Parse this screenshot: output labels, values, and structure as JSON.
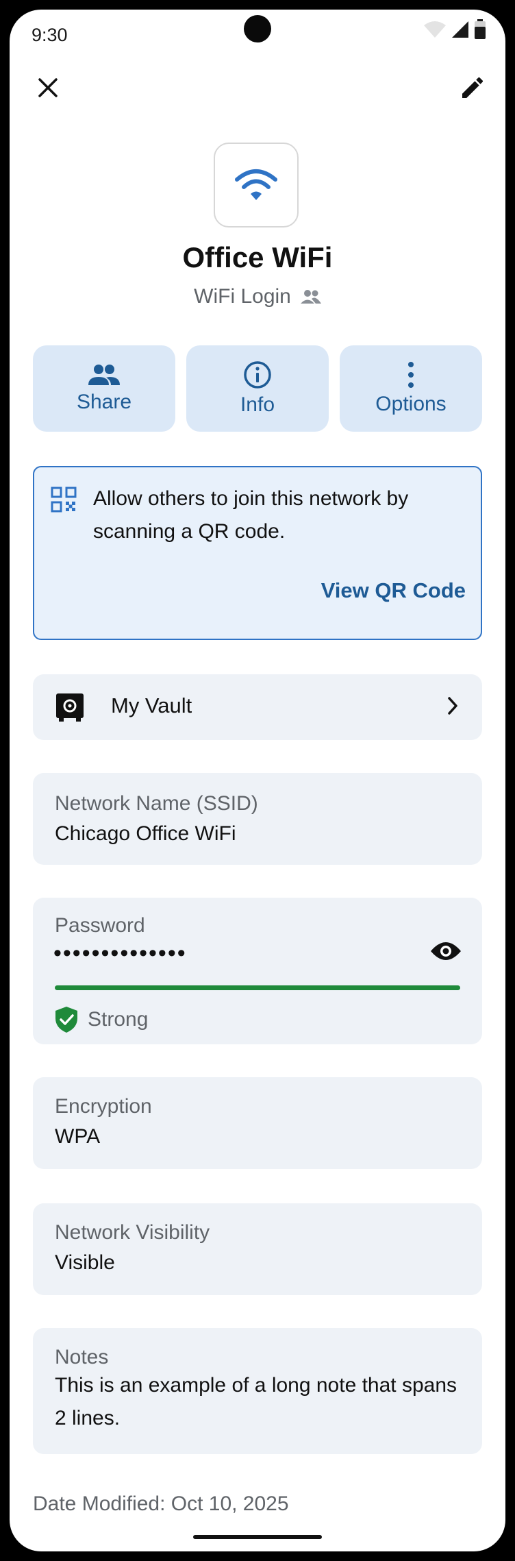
{
  "status_bar": {
    "time": "9:30"
  },
  "header": {
    "title": "Office WiFi",
    "subtitle": "WiFi Login",
    "icon": "wifi-icon"
  },
  "actions": [
    {
      "label": "Share",
      "icon": "people-icon"
    },
    {
      "label": "Info",
      "icon": "info-icon"
    },
    {
      "label": "Options",
      "icon": "more-vert-icon"
    }
  ],
  "qr_banner": {
    "text": "Allow others to join this network by scanning a QR code.",
    "link": "View QR Code"
  },
  "vault": {
    "label": "My Vault"
  },
  "fields": {
    "ssid": {
      "label": "Network Name (SSID)",
      "value": "Chicago Office WiFi"
    },
    "password": {
      "label": "Password",
      "masked": "••••••••••••••",
      "strength": "Strong",
      "strength_level": 1.0
    },
    "encryption": {
      "label": "Encryption",
      "value": "WPA"
    },
    "visibility": {
      "label": "Network Visibility",
      "value": "Visible"
    },
    "notes": {
      "label": "Notes",
      "value": "This is an example of a long note that spans 2 lines."
    }
  },
  "footer": {
    "modified": "Date Modified: Oct 10, 2025"
  },
  "colors": {
    "accent": "#1e5b95",
    "action_bg": "#dbe8f7",
    "card_bg": "#eef2f7",
    "strong": "#1f8a3a"
  }
}
